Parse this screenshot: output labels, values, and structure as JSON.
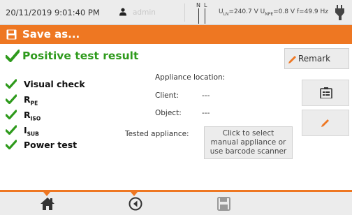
{
  "status_bar": {
    "datetime": "20/11/2019 9:01:40 PM",
    "user": "admin",
    "nl_n": "N",
    "nl_l": "L",
    "uln_label": "U",
    "uln_sub": "LN",
    "uln_value": "=240.7 V",
    "unpe_label": "U",
    "unpe_sub": "NPE",
    "unpe_value": "=0.8 V",
    "freq": "f=49.9 Hz",
    "user_icon": "user-icon",
    "plug_icon": "plug-icon"
  },
  "title_bar": {
    "title": "Save as...",
    "icon": "floppy-disk-icon"
  },
  "result": {
    "title": "Positive test result",
    "icon": "check-icon"
  },
  "checks": [
    {
      "label": "Visual check",
      "sub": ""
    },
    {
      "label": "R",
      "sub": "PE"
    },
    {
      "label": "R",
      "sub": "ISO"
    },
    {
      "label": "I",
      "sub": "SUB"
    },
    {
      "label": "Power test",
      "sub": ""
    }
  ],
  "info": {
    "appliance_location_label": "Appliance location:",
    "client_label": "Client:",
    "client_value": "---",
    "object_label": "Object:",
    "object_value": "---",
    "tested_appliance_label": "Tested appliance:",
    "select_line1": "Click to select",
    "select_line2": "manual appliance or",
    "select_line3": "use barcode scanner"
  },
  "buttons": {
    "remark_label": "Remark",
    "remark_icon": "pencil-icon",
    "clipboard_icon": "clipboard-icon",
    "edit_icon": "pencil-icon"
  },
  "bottom_bar": {
    "home_icon": "home-icon",
    "back_icon": "back-icon",
    "save_icon": "floppy-disk-icon"
  },
  "colors": {
    "accent": "#ee7722",
    "success": "#2e9a1c",
    "bar": "#ececec"
  }
}
